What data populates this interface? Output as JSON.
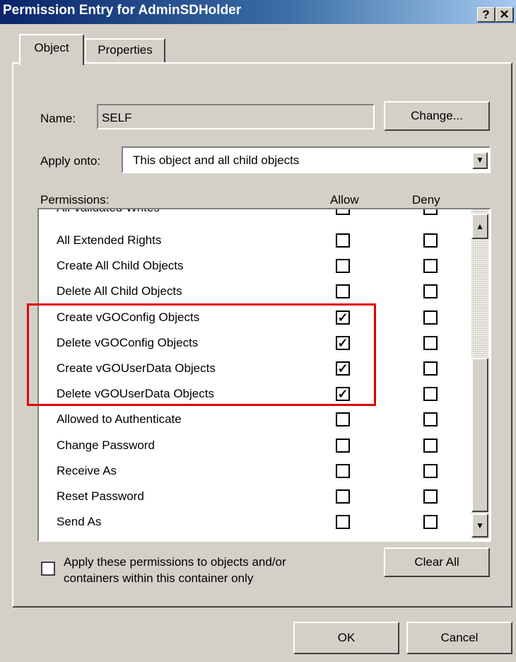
{
  "window": {
    "title": "Permission Entry for AdminSDHolder",
    "help_button": "?",
    "close_button": "✕"
  },
  "tabs": [
    {
      "label": "Object",
      "active": true
    },
    {
      "label": "Properties",
      "active": false
    }
  ],
  "name_field": {
    "label": "Name:",
    "value": "SELF",
    "change_button": "Change..."
  },
  "apply_onto": {
    "label": "Apply onto:",
    "value": "This object and all child objects"
  },
  "permissions": {
    "label": "Permissions:",
    "allow_header": "Allow",
    "deny_header": "Deny",
    "partial_top_row": "All Validated Writes",
    "items": [
      {
        "name": "All Extended Rights",
        "allow": false,
        "deny": false
      },
      {
        "name": "Create All Child Objects",
        "allow": false,
        "deny": false
      },
      {
        "name": "Delete All Child Objects",
        "allow": false,
        "deny": false
      },
      {
        "name": "Create vGOConfig Objects",
        "allow": true,
        "deny": false
      },
      {
        "name": "Delete vGOConfig Objects",
        "allow": true,
        "deny": false
      },
      {
        "name": "Create vGOUserData Objects",
        "allow": true,
        "deny": false
      },
      {
        "name": "Delete vGOUserData Objects",
        "allow": true,
        "deny": false
      },
      {
        "name": "Allowed to Authenticate",
        "allow": false,
        "deny": false
      },
      {
        "name": "Change Password",
        "allow": false,
        "deny": false
      },
      {
        "name": "Receive As",
        "allow": false,
        "deny": false
      },
      {
        "name": "Reset Password",
        "allow": false,
        "deny": false
      },
      {
        "name": "Send As",
        "allow": false,
        "deny": false
      }
    ]
  },
  "apply_container_only": {
    "line1": "Apply these permissions to objects and/or",
    "line2": "containers within this container only",
    "checked": false
  },
  "clear_all_button": "Clear All",
  "ok_button": "OK",
  "cancel_button": "Cancel",
  "colors": {
    "highlight_box": "#e00000",
    "titlebar_start": "#0a246a",
    "face": "#d4d0c8"
  }
}
